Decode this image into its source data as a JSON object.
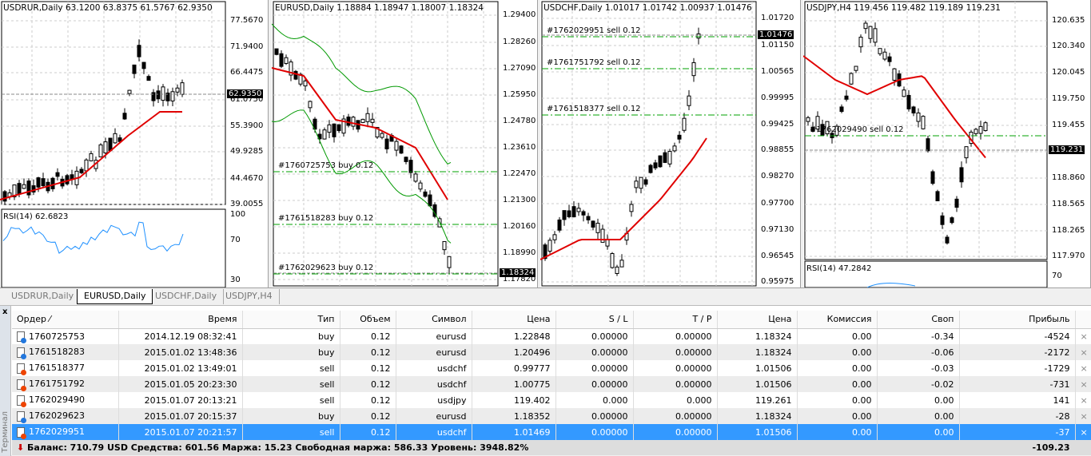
{
  "charts": [
    {
      "id": "usdrur",
      "title": "USDRUR,Daily  63.1200 63.8375 61.5767 62.9350",
      "axis": [
        "77.5670",
        "71.9400",
        "66.4475",
        "61.0750",
        "55.3900",
        "49.9285",
        "44.4670",
        "39.0055"
      ],
      "current": "62.9350",
      "sub": {
        "label": "RSI(14) 62.6823",
        "levels": [
          "100",
          "70",
          "30"
        ]
      },
      "orders": []
    },
    {
      "id": "eurusd",
      "title": "EURUSD,Daily  1.18884 1.18947 1.18007 1.18324",
      "axis": [
        "1.29400",
        "1.28260",
        "1.27090",
        "1.25950",
        "1.24780",
        "1.23610",
        "1.22470",
        "1.21300",
        "1.20160",
        "1.18990",
        "1.17820"
      ],
      "current": "1.18324",
      "orders": [
        "#1760725753 buy 0.12",
        "#1761518283 buy 0.12",
        "#1762029623 buy 0.12"
      ]
    },
    {
      "id": "usdchf",
      "title": "USDCHF,Daily  1.01017 1.01742 1.00937 1.01476",
      "axis": [
        "1.01720",
        "1.01150",
        "1.00565",
        "0.99995",
        "0.99425",
        "0.98855",
        "0.98270",
        "0.97700",
        "0.97130",
        "0.96545",
        "0.95975"
      ],
      "current": "1.01476",
      "orders": [
        "#1762029951 sell 0.12",
        "#1761751792 sell 0.12",
        "#1761518377 sell 0.12"
      ]
    },
    {
      "id": "usdjpy",
      "title": "USDJPY,H4  119.456 119.482 119.189 119.231",
      "axis": [
        "120.635",
        "120.340",
        "120.045",
        "119.750",
        "119.455",
        "119.155",
        "118.860",
        "118.565",
        "118.265",
        "117.970"
      ],
      "current": "119.231",
      "sub": {
        "label": "RSI(14) 47.2842",
        "levels": [
          "70"
        ]
      },
      "orders": [
        "#1762029490 sell 0.12"
      ]
    }
  ],
  "tabs": [
    "USDRUR,Daily",
    "EURUSD,Daily",
    "USDCHF,Daily",
    "USDJPY,H4"
  ],
  "active_tab": 1,
  "terminal": {
    "side_label": "Терминал",
    "columns": [
      "Ордер",
      "Время",
      "Тип",
      "Объем",
      "Символ",
      "Цена",
      "S / L",
      "T / P",
      "Цена",
      "Комиссия",
      "Своп",
      "Прибыль"
    ],
    "rows": [
      [
        "1760725753",
        "2014.12.19 08:32:41",
        "buy",
        "0.12",
        "eurusd",
        "1.22848",
        "0.00000",
        "0.00000",
        "1.18324",
        "0.00",
        "-0.34",
        "-4524"
      ],
      [
        "1761518283",
        "2015.01.02 13:48:36",
        "buy",
        "0.12",
        "eurusd",
        "1.20496",
        "0.00000",
        "0.00000",
        "1.18324",
        "0.00",
        "-0.06",
        "-2172"
      ],
      [
        "1761518377",
        "2015.01.02 13:49:01",
        "sell",
        "0.12",
        "usdchf",
        "0.99777",
        "0.00000",
        "0.00000",
        "1.01506",
        "0.00",
        "-0.03",
        "-1729"
      ],
      [
        "1761751792",
        "2015.01.05 20:23:30",
        "sell",
        "0.12",
        "usdchf",
        "1.00775",
        "0.00000",
        "0.00000",
        "1.01506",
        "0.00",
        "-0.02",
        "-731"
      ],
      [
        "1762029490",
        "2015.01.07 20:13:21",
        "sell",
        "0.12",
        "usdjpy",
        "119.402",
        "0.000",
        "0.000",
        "119.261",
        "0.00",
        "0.00",
        "141"
      ],
      [
        "1762029623",
        "2015.01.07 20:15:37",
        "buy",
        "0.12",
        "eurusd",
        "1.18352",
        "0.00000",
        "0.00000",
        "1.18324",
        "0.00",
        "0.00",
        "-28"
      ],
      [
        "1762029951",
        "2015.01.07 20:21:57",
        "sell",
        "0.12",
        "usdchf",
        "1.01469",
        "0.00000",
        "0.00000",
        "1.01506",
        "0.00",
        "0.00",
        "-37"
      ]
    ],
    "selected_row": 6,
    "status": "Баланс: 710.79 USD  Средства: 601.56  Маржа: 15.23  Свободная маржа: 586.33  Уровень: 3948.82%",
    "total_profit": "-109.23",
    "close_glyph": "×"
  },
  "colors": {
    "bull": "#ffffff",
    "bear": "#000000",
    "ma": "#e00000",
    "bands": "#009900",
    "rsi": "#1e90ff",
    "order": "#00a000",
    "selected": "#3399ff"
  }
}
